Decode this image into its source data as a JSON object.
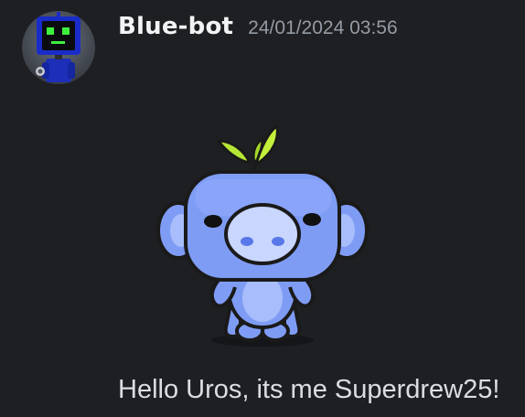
{
  "message": {
    "author": {
      "username": "Blue-bot",
      "avatar_icon": "robot-avatar-icon"
    },
    "timestamp": "24/01/2024 03:56",
    "sticker": {
      "icon": "wumpus-sticker-icon",
      "body_color": "#7f9cf5",
      "leaf_color": "#b4e639"
    },
    "content": "Hello Uros, its me Superdrew25!"
  },
  "colors": {
    "background": "#1e1f22",
    "username": "#f2f3f5",
    "timestamp": "#949ba4",
    "text": "#dbdee1"
  }
}
